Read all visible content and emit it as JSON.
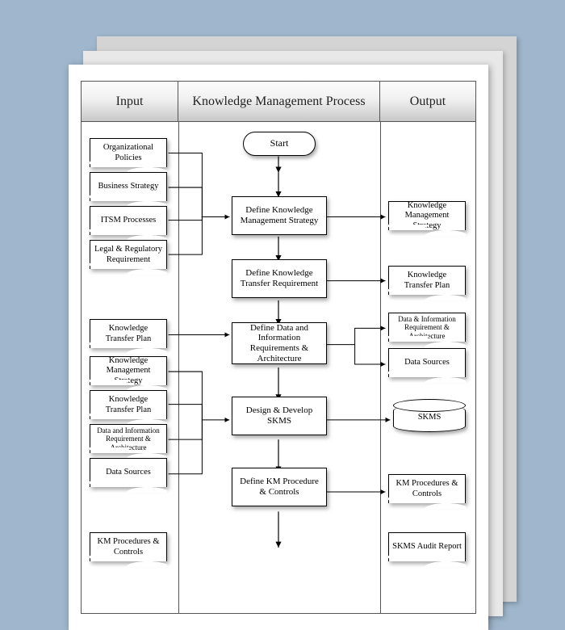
{
  "columns": {
    "input": "Input",
    "process": "Knowledge Management Process",
    "output": "Output"
  },
  "start": "Start",
  "inputs": {
    "org_policies": "Organizational Policies",
    "business_strategy": "Business Strategy",
    "itsm_processes": "ITSM Processes",
    "legal_regulatory": "Legal & Regulatory Requirement",
    "ktp": "Knowledge Transfer Plan",
    "km_strategy": "Knowledge Management Strategy",
    "ktp2": "Knowledge Transfer Plan",
    "data_info_req": "Data and Information Requirement & Architecture",
    "data_sources": "Data Sources",
    "km_proc_controls": "KM Procedures & Controls"
  },
  "processes": {
    "p1": "Define Knowledge Management Strategy",
    "p2": "Define Knowledge Transfer Requirement",
    "p3": "Define Data and Information Requirements & Architecture",
    "p4": "Design & Develop SKMS",
    "p5": "Define KM Procedure & Controls"
  },
  "outputs": {
    "o1": "Knowledge Management Strategy",
    "o2": "Knowledge Transfer Plan",
    "o3a": "Data & Information Requirement & Architecture",
    "o3b": "Data Sources",
    "o4": "SKMS",
    "o5": "KM Procedures & Controls",
    "o6": "SKMS Audit Report"
  }
}
